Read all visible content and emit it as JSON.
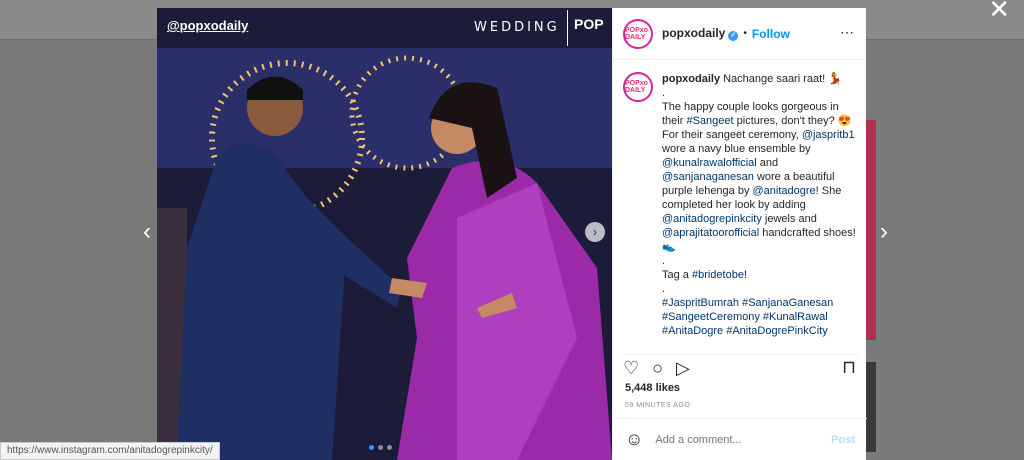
{
  "close_label": "✕",
  "nav": {
    "prev": "‹",
    "next": "›"
  },
  "photo": {
    "handle": "@popxodaily",
    "tag": "WEDDING",
    "logo": "POP",
    "next_arrow": "›"
  },
  "header": {
    "username": "popxodaily",
    "verified": "✓",
    "bullet": "•",
    "follow": "Follow",
    "more": "⋯",
    "avatar_text": "POPxo DAILY"
  },
  "caption": {
    "username": "popxodaily",
    "line1": " Nachange saari raat! 💃",
    "dot1": ".",
    "p1": "The happy couple looks gorgeous in their ",
    "tag_sangeet": "#Sangeet",
    "p1b": " pictures, don't they? 😍",
    "p2a": "For their sangeet ceremony, ",
    "m1": "@jaspritb1",
    "p2b": " wore a navy blue ensemble by ",
    "m2": "@kunalrawalofficial",
    "p2c": " and ",
    "m3": "@sanjanaganesan",
    "p2d": " wore a beautiful purple lehenga by ",
    "m4": "@anitadogre",
    "p2e": "! She completed her look by adding ",
    "m5": "@anitadogrepinkcity",
    "p2f": " jewels and ",
    "m6": "@aprajitatoorofficial",
    "p2g": " handcrafted shoes! 👟",
    "dot2": ".",
    "p3a": "Tag a ",
    "tag_bride": "#bridetobe",
    "p3b": "!",
    "dot3": ".",
    "hashtags": "#JaspritBumrah #SanjanaGanesan #SangeetCeremony #KunalRawal #AnitaDogre #AnitaDogrePinkCity"
  },
  "actions": {
    "like": "♡",
    "comment": "○",
    "share": "▷",
    "save": "⊓"
  },
  "likes": "5,448 likes",
  "time_ago": "59 MINUTES AGO",
  "comment": {
    "emoji": "☺",
    "placeholder": "Add a comment...",
    "post": "Post"
  },
  "status_url": "https://www.instagram.com/anitadogrepinkcity/",
  "colors": {
    "accent": "#0095f6",
    "backdrop": "#7a7a7a",
    "lehenga": "#9b2aa8",
    "sherwani": "#1f2e63"
  }
}
